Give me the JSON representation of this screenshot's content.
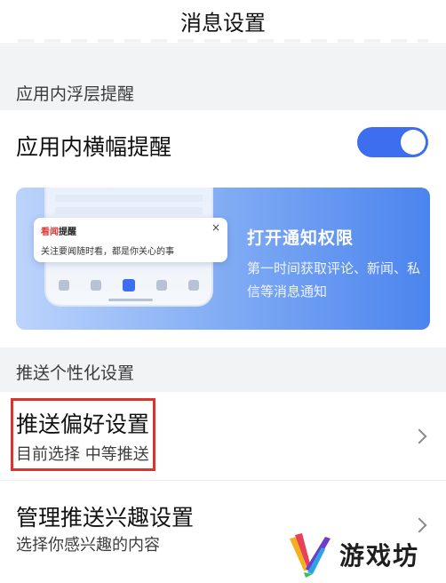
{
  "header": {
    "title": "消息设置"
  },
  "in_app": {
    "section_label": "应用内浮层提醒",
    "banner_row_title": "应用内横幅提醒",
    "banner_toggle_on": true,
    "accent_color": "#3d6ef0"
  },
  "promo_banner": {
    "notif_app_brand": "看闻",
    "notif_app_rest": "提醒",
    "notif_message": "关注要闻随时看，都是你关心的事",
    "close_glyph": "×",
    "title": "打开通知权限",
    "desc": "第一时间获取评论、新闻、私信等消息通知"
  },
  "push": {
    "section_label": "推送个性化设置",
    "items": [
      {
        "title": "推送偏好设置",
        "subtitle": "目前选择 中等推送",
        "highlighted": true
      },
      {
        "title": "管理推送兴趣设置",
        "subtitle": "选择你感兴趣的内容"
      }
    ]
  },
  "watermark": {
    "text": "游戏坊",
    "logo_icon": "multicolor-v-logo"
  }
}
